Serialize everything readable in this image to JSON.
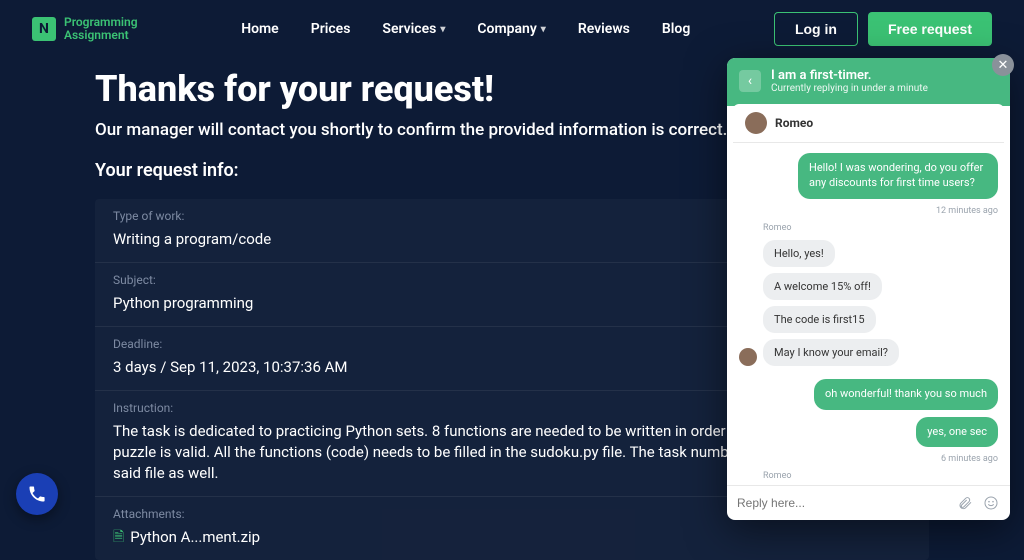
{
  "brand": {
    "name": "Programming\nAssignment"
  },
  "nav": {
    "home": "Home",
    "prices": "Prices",
    "services": "Services",
    "company": "Company",
    "reviews": "Reviews",
    "blog": "Blog"
  },
  "header_actions": {
    "login": "Log in",
    "free_request": "Free request"
  },
  "page": {
    "title": "Thanks for your request!",
    "subtitle": "Our manager will contact you shortly to confirm the provided information is correct.",
    "info_head": "Your request info:"
  },
  "info": {
    "type_label": "Type of work:",
    "type_value": "Writing a program/code",
    "subject_label": "Subject:",
    "subject_value": "Python programming",
    "deadline_label": "Deadline:",
    "deadline_value": "3 days / Sep 11, 2023, 10:37:36 AM",
    "instruction_label": "Instruction:",
    "instruction_value": "The task is dedicated to practicing Python sets. 8 functions are needed to be written in order to determine if a Sudoku puzzle is valid. All the functions (code) needs to be filled in the sudoku.py file. The task number descriptions are in the said file as well.",
    "attach_label": "Attachments:",
    "attach_value": "Python A...ment.zip"
  },
  "chat": {
    "head_title": "I am a first-timer.",
    "head_sub": "Currently replying in under a minute",
    "agent": "Romeo",
    "m1": "Hello! I was wondering, do you offer any discounts for first time users?",
    "ts1": "12 minutes ago",
    "a1": "Hello, yes!",
    "a2": "A welcome 15% off!",
    "a3": "The code is first15",
    "a4": "May I know your email?",
    "m2": "oh wonderful! thank you so much",
    "m3": "yes, one sec",
    "ts2": "6 minutes ago",
    "name_label": "Romeo",
    "placeholder": "Reply here..."
  }
}
